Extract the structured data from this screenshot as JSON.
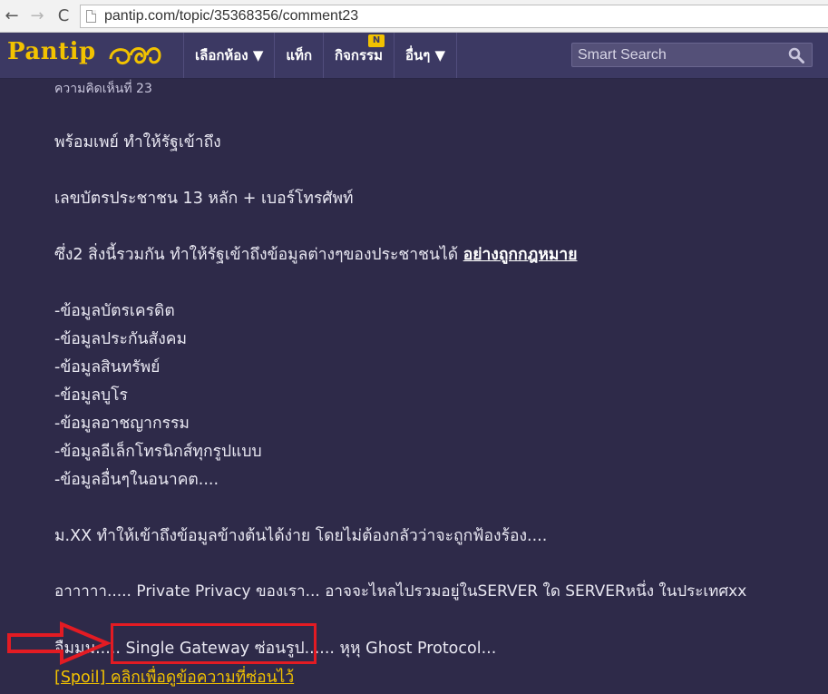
{
  "browser": {
    "url": "pantip.com/topic/35368356/comment23",
    "back_glyph": "←",
    "forward_glyph": "→",
    "reload_glyph": "C"
  },
  "header": {
    "logo_text": "Pantip",
    "logo_mark": "ๅ๑",
    "menu": [
      {
        "label": "เลือกห้อง ▼"
      },
      {
        "label": "แท็ก"
      },
      {
        "label": "กิจกรรม",
        "badge": "N"
      },
      {
        "label": "อื่นๆ ▼"
      }
    ],
    "search_placeholder": "Smart Search"
  },
  "comment": {
    "number_label": "ความคิดเห็นที่ 23",
    "lines": [
      "พร้อมเพย์ ทำให้รัฐเข้าถึง",
      "เลขบัตรประชาชน 13 หลัก + เบอร์โทรศัพท์",
      "ซึ่ง2 สิ่งนี้รวมกัน ทำให้รัฐเข้าถึงข้อมูลต่างๆของประชาชนได้",
      "อย่างถูกกฎหมาย",
      "-ข้อมูลบัตรเครดิต",
      "-ข้อมูลประกันสังคม",
      "-ข้อมูลสินทรัพย์",
      "-ข้อมูลบูโร",
      "-ข้อมูลอาชญากรรม",
      "-ข้อมูลอีเล็กโทรนิกส์ทุกรูปแบบ",
      "-ข้อมูลอื่นๆในอนาคต....",
      "ม.XX ทำให้เข้าถึงข้อมูลข้างต้นได้ง่าย โดยไม่ต้องกลัวว่าจะถูกฟ้องร้อง....",
      "อาาาาา..... Private Privacy ของเรา... อาจจะไหลไปรวมอยู่ในSERVER ใด SERVERหนึ่ง ในประเทศxx",
      "อืมมม..... Single Gateway ซ่อนรูป...... หุหุ Ghost Protocol..."
    ],
    "spoil_link": "[Spoil] คลิกเพื่อดูข้อความที่ซ่อนไว้"
  },
  "colors": {
    "background": "#2e2a49",
    "header": "#3c3963",
    "accent": "#f2c200",
    "annotation": "#e31b23"
  }
}
